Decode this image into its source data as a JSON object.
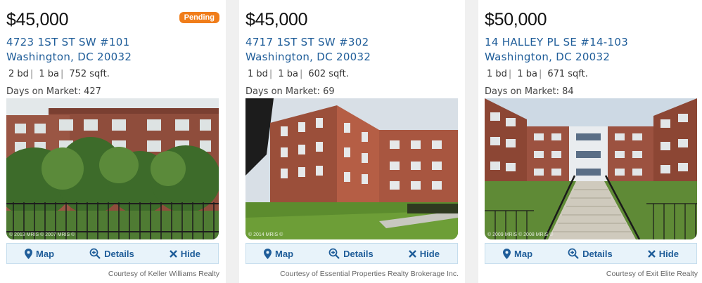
{
  "listings": [
    {
      "price": "$45,000",
      "badge": "Pending",
      "address_line1": "4723 1ST ST SW #101",
      "address_line2": "Washington, DC 20032",
      "beds": "2 bd",
      "baths": "1 ba",
      "sqft": "752 sqft.",
      "days_on_market": "Days on Market: 427",
      "photo_credit": "© 2013 MRIS © 2007 MRIS ©",
      "courtesy": "Courtesy of Keller Williams Realty"
    },
    {
      "price": "$45,000",
      "badge": "",
      "address_line1": "4717 1ST ST SW #302",
      "address_line2": "Washington, DC 20032",
      "beds": "1 bd",
      "baths": "1 ba",
      "sqft": "602 sqft.",
      "days_on_market": "Days on Market: 69",
      "photo_credit": "© 2014 MRIS ©",
      "courtesy": "Courtesy of Essential Properties Realty Brokerage Inc."
    },
    {
      "price": "$50,000",
      "badge": "",
      "address_line1": "14 HALLEY PL SE #14-103",
      "address_line2": "Washington, DC 20032",
      "beds": "1 bd",
      "baths": "1 ba",
      "sqft": "671 sqft.",
      "days_on_market": "Days on Market: 84",
      "photo_credit": "© 2009 MRIS © 2008 MRIS ©",
      "courtesy": "Courtesy of Exit Elite Realty"
    }
  ],
  "actions": {
    "map_label": "Map",
    "details_label": "Details",
    "hide_label": "Hide"
  },
  "spec_separator": "|",
  "colors": {
    "badge": "#f07d1a",
    "link": "#1f5d99",
    "action_bar": "#e8f3fa"
  },
  "icons": [
    "map-pin-icon",
    "zoom-plus-icon",
    "close-x-icon"
  ]
}
